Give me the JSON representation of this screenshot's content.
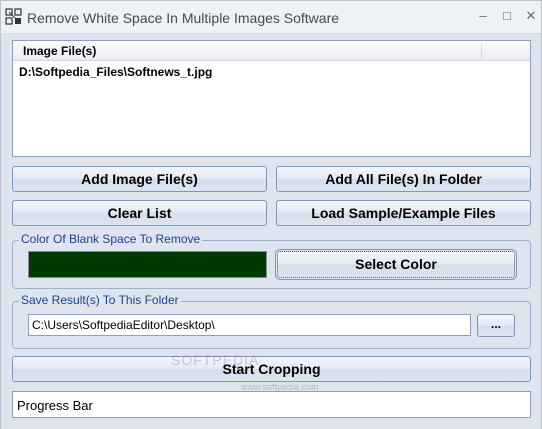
{
  "window": {
    "title": "Remove White Space In Multiple Images Software",
    "min_glyph": "–",
    "max_glyph": "□",
    "close_glyph": "✕"
  },
  "file_list": {
    "column_header": "Image File(s)",
    "rows": [
      "D:\\Softpedia_Files\\Softnews_t.jpg"
    ]
  },
  "buttons": {
    "add_images": "Add Image File(s)",
    "add_folder": "Add All File(s) In Folder",
    "clear_list": "Clear List",
    "load_sample": "Load Sample/Example Files",
    "select_color": "Select Color",
    "browse": "...",
    "start": "Start Cropping"
  },
  "color_group": {
    "label": "Color Of Blank Space To Remove",
    "swatch_color": "#003a00"
  },
  "save_group": {
    "label": "Save Result(s) To This Folder",
    "path_value": "C:\\Users\\SoftpediaEditor\\Desktop\\"
  },
  "progress": {
    "label": "Progress Bar",
    "value": 0
  },
  "watermark": {
    "text": "SOFTPEDIA",
    "url": "www.softpedia.com"
  }
}
